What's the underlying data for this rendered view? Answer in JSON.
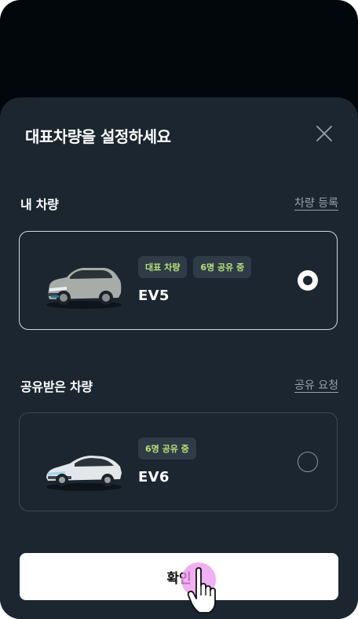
{
  "sheet": {
    "title": "대표차량을 설정하세요"
  },
  "my_cars": {
    "title": "내 차량",
    "link": "차량 등록",
    "cars": [
      {
        "name": "EV5",
        "badges": [
          "대표 차량",
          "6명 공유 중"
        ],
        "selected": true
      }
    ]
  },
  "shared_cars": {
    "title": "공유받은 차량",
    "link": "공유 요청",
    "cars": [
      {
        "name": "EV6",
        "badges": [
          "6명 공유 중"
        ],
        "selected": false
      }
    ]
  },
  "confirm": {
    "label": "확인"
  },
  "colors": {
    "background": "#02070b",
    "sheet": "#1b2631",
    "badge_bg": "#2f3b47",
    "badge_text": "#b7e07a",
    "tap_highlight": "#ec96ec"
  },
  "icons": [
    "close-icon",
    "radio-checked-icon",
    "radio-unchecked-icon",
    "hand-pointer-icon"
  ]
}
